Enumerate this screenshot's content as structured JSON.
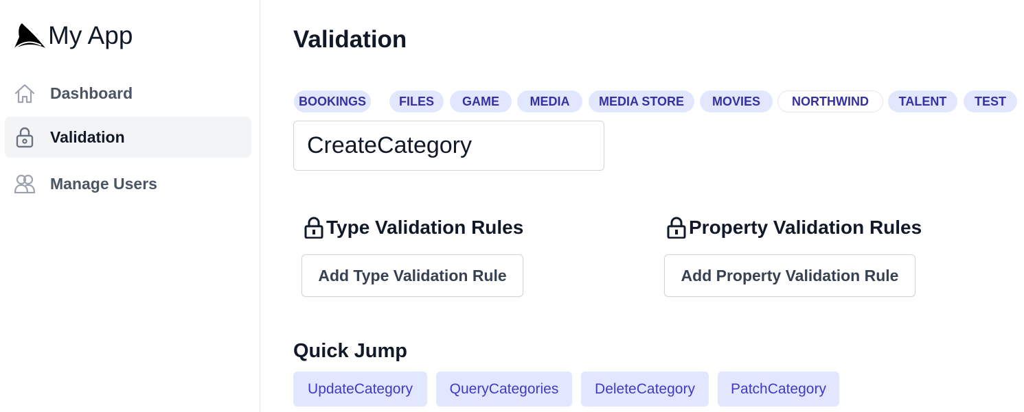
{
  "app": {
    "name": "My App"
  },
  "sidebar": {
    "items": [
      {
        "label": "Dashboard",
        "icon": "home-icon"
      },
      {
        "label": "Validation",
        "icon": "lock-icon",
        "active": true
      },
      {
        "label": "Manage Users",
        "icon": "users-icon"
      }
    ]
  },
  "page": {
    "title": "Validation"
  },
  "tabs": [
    "BOOKINGS",
    "FILES",
    "GAME",
    "MEDIA",
    "MEDIA STORE",
    "MOVIES",
    "NORTHWIND",
    "TALENT",
    "TEST"
  ],
  "selected_tab": "NORTHWIND",
  "operation": {
    "value": "CreateCategory"
  },
  "type_rules": {
    "title": "Type Validation Rules",
    "button_label": "Add Type Validation Rule"
  },
  "property_rules": {
    "title": "Property Validation Rules",
    "button_label": "Add Property Validation Rule"
  },
  "quick_jump": {
    "title": "Quick Jump",
    "links": [
      "UpdateCategory",
      "QueryCategories",
      "DeleteCategory",
      "PatchCategory"
    ]
  },
  "colors": {
    "tab_bg": "#e0e7ff",
    "tab_text": "#3730a3",
    "link_text": "#4338ca",
    "active_nav_bg": "#f3f4f6"
  }
}
